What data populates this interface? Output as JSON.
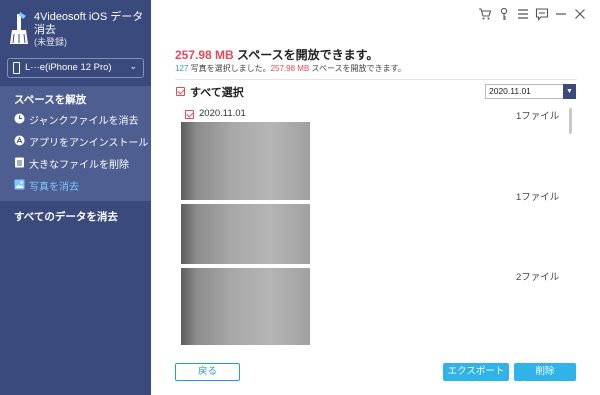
{
  "app": {
    "name_line1": "4Videosoft iOS データ",
    "name_line2": "消去",
    "status": "(未登録)"
  },
  "device": {
    "name": "L···e(iPhone 12 Pro)"
  },
  "sidebar": {
    "section_title": "スペースを解放",
    "items": [
      {
        "label": "ジャンクファイルを消去",
        "icon": "clock-icon",
        "active": false
      },
      {
        "label": "アプリをアンインストール",
        "icon": "app-store-icon",
        "active": false
      },
      {
        "label": "大きなファイルを削除",
        "icon": "file-icon",
        "active": false
      },
      {
        "label": "写真を消去",
        "icon": "photo-icon",
        "active": true
      }
    ],
    "erase_all": "すべてのデータを消去"
  },
  "window_controls": [
    {
      "name": "cart-icon"
    },
    {
      "name": "key-icon"
    },
    {
      "name": "menu-icon"
    },
    {
      "name": "feedback-icon"
    },
    {
      "name": "minimize-icon"
    },
    {
      "name": "close-icon"
    }
  ],
  "summary": {
    "amount": "257.98 MB",
    "headline_suffix": " スペースを開放できます。",
    "count": "127",
    "sub_mid": " 写真を選択しました。",
    "sub_amount": "257.98 MB",
    "sub_suffix": " スペースを開放できます。"
  },
  "list": {
    "select_all": "すべて選択",
    "date_filter": "2020.11.01",
    "group_date": "2020.11.01",
    "groups": [
      {
        "count": "1ファイル"
      },
      {
        "count": "1ファイル"
      },
      {
        "count": "2ファイル"
      }
    ]
  },
  "buttons": {
    "back": "戻る",
    "export": "エクスポート",
    "delete": "削除"
  },
  "colors": {
    "sidebar": "#3a4a7c",
    "sidebar_section": "#4e5e91",
    "accent": "#2fb3e8",
    "highlight": "#e04a5a"
  }
}
